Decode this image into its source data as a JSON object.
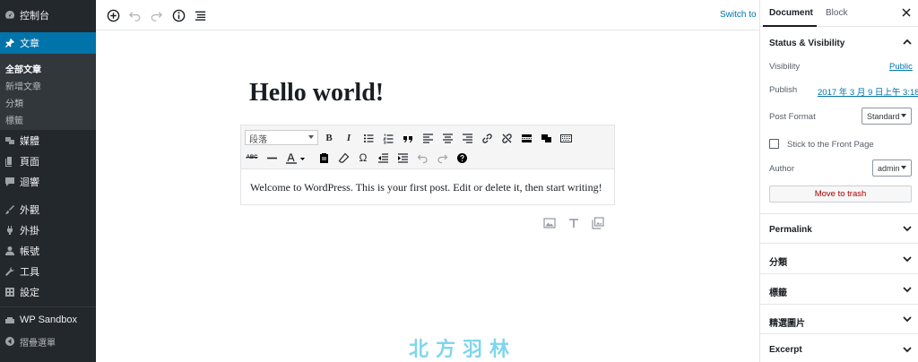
{
  "admin_menu": {
    "items": [
      {
        "label": "控制台",
        "icon": "dashboard-icon"
      },
      {
        "label": "文章",
        "icon": "pin-icon"
      },
      {
        "label": "媒體",
        "icon": "media-icon"
      },
      {
        "label": "頁面",
        "icon": "page-icon"
      },
      {
        "label": "迴響",
        "icon": "comment-icon"
      },
      {
        "label": "外觀",
        "icon": "brush-icon"
      },
      {
        "label": "外掛",
        "icon": "plug-icon"
      },
      {
        "label": "帳號",
        "icon": "user-icon"
      },
      {
        "label": "工具",
        "icon": "wrench-icon"
      },
      {
        "label": "設定",
        "icon": "settings-icon"
      },
      {
        "label": "WP Sandbox",
        "icon": "sandbox-icon"
      },
      {
        "label": "摺疊選單",
        "icon": "collapse-icon"
      }
    ],
    "submenu": [
      "全部文章",
      "新增文章",
      "分類",
      "標籤"
    ],
    "colors": {
      "background": "#23282d",
      "active": "#0073aa",
      "submenu": "#32373c"
    }
  },
  "editor_toolbar": {
    "icons": [
      "add-block-icon",
      "undo-icon",
      "redo-icon",
      "info-icon",
      "outline-icon"
    ],
    "switch_draft_label": "Switch to D"
  },
  "post": {
    "title": "Hello world!",
    "content": "Welcome to WordPress. This is your first post. Edit or delete it, then start writing!"
  },
  "classic_toolbar": {
    "format_value": "段落",
    "row1": [
      "bold",
      "italic",
      "bulleted-list",
      "numbered-list",
      "blockquote",
      "align-left",
      "align-center",
      "align-right",
      "insert-link",
      "remove-link",
      "read-more",
      "toolbar-toggle",
      "keyboard"
    ],
    "row2": [
      "strikethrough",
      "horizontal-line",
      "text-color",
      "paste-as-text",
      "clear-formatting",
      "special-character",
      "decrease-indent",
      "increase-indent",
      "undo",
      "redo",
      "help"
    ]
  },
  "inserter_icons": [
    "image-icon",
    "text-icon",
    "gallery-icon"
  ],
  "watermark": "北方羽林",
  "settings": {
    "tabs": {
      "document": "Document",
      "block": "Block"
    },
    "status_visibility": {
      "title": "Status & Visibility",
      "visibility_label": "Visibility",
      "visibility_value": "Public",
      "publish_label": "Publish",
      "publish_value": "2017 年 3 月 9 日上午 3:18",
      "format_label": "Post Format",
      "format_value": "Standard",
      "sticky_label": "Stick to the Front Page",
      "author_label": "Author",
      "author_value": "admin",
      "trash_label": "Move to trash"
    },
    "panels": [
      "Permalink",
      "分類",
      "標籤",
      "精選圖片",
      "Excerpt"
    ]
  }
}
